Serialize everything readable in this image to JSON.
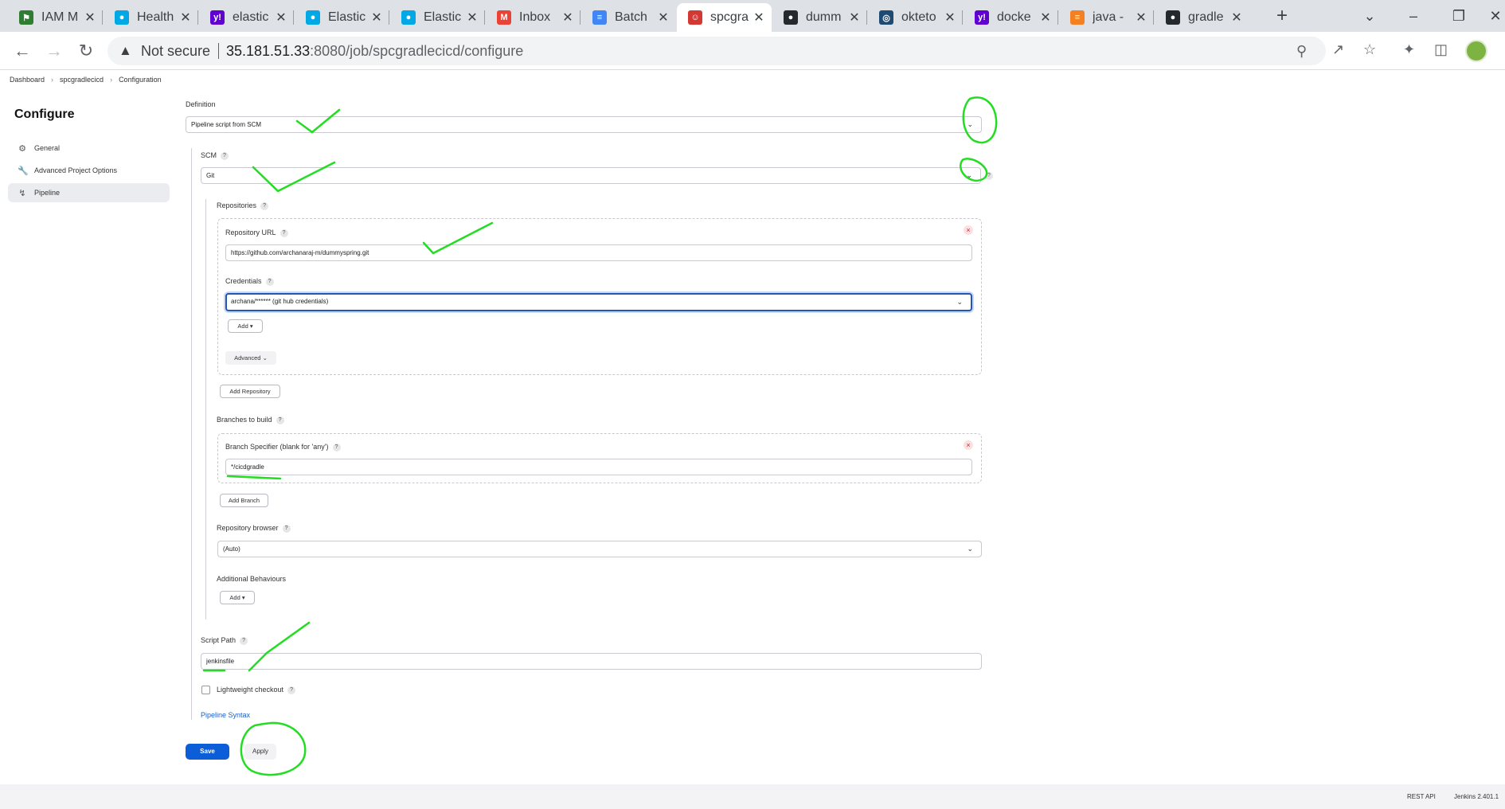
{
  "browser": {
    "tabs": [
      {
        "title": "IAM M",
        "icon": "aws-icon",
        "color": "#2e7d32"
      },
      {
        "title": "Health",
        "icon": "elastic-icon",
        "color": "#00a9e5"
      },
      {
        "title": "elastic",
        "icon": "yahoo-icon",
        "color": "#6001d2"
      },
      {
        "title": "Elastic",
        "icon": "elastic-icon",
        "color": "#00a9e5"
      },
      {
        "title": "Elastic",
        "icon": "elastic-icon",
        "color": "#00a9e5"
      },
      {
        "title": "Inbox",
        "icon": "gmail-icon",
        "color": "#ea4335"
      },
      {
        "title": "Batch",
        "icon": "docs-icon",
        "color": "#4285f4"
      },
      {
        "title": "spcgra",
        "icon": "jenkins-icon",
        "color": "#d33833"
      },
      {
        "title": "dumm",
        "icon": "github-icon",
        "color": "#24292e"
      },
      {
        "title": "okteto",
        "icon": "okteto-icon",
        "color": "#1f4a72"
      },
      {
        "title": "docke",
        "icon": "yahoo-icon",
        "color": "#6001d2"
      },
      {
        "title": "java -",
        "icon": "stackoverflow-icon",
        "color": "#f48024"
      },
      {
        "title": "gradle",
        "icon": "github-icon",
        "color": "#24292e"
      }
    ],
    "not_secure": "Not secure",
    "url_host": "35.181.51.33",
    "url_path": ":8080/job/spcgradlecicd/configure"
  },
  "breadcrumb": {
    "items": [
      "Dashboard",
      "spcgradlecicd",
      "Configuration"
    ]
  },
  "sidebar": {
    "title": "Configure",
    "items": [
      {
        "label": "General",
        "icon": "gear-icon"
      },
      {
        "label": "Advanced Project Options",
        "icon": "wrench-icon"
      },
      {
        "label": "Pipeline",
        "icon": "pipeline-icon"
      }
    ]
  },
  "form": {
    "definition_label": "Definition",
    "definition_value": "Pipeline script from SCM",
    "scm_label": "SCM",
    "scm_value": "Git",
    "repositories_label": "Repositories",
    "repo_url_label": "Repository URL",
    "repo_url_value": "https://github.com/archanaraj-m/dummyspring.git",
    "credentials_label": "Credentials",
    "credentials_value": "archana/****** (git hub credentials)",
    "add_label": "Add",
    "advanced_label": "Advanced",
    "add_repository_label": "Add Repository",
    "branches_label": "Branches to build",
    "branch_spec_label": "Branch Specifier (blank for 'any')",
    "branch_spec_value": "*/cicdgradle",
    "add_branch_label": "Add Branch",
    "repo_browser_label": "Repository browser",
    "repo_browser_value": "(Auto)",
    "additional_behaviours_label": "Additional Behaviours",
    "add_behaviour_label": "Add",
    "script_path_label": "Script Path",
    "script_path_value": "jenkinsfile",
    "lightweight_label": "Lightweight checkout",
    "pipeline_syntax_label": "Pipeline Syntax",
    "save_label": "Save",
    "apply_label": "Apply"
  },
  "footer": {
    "rest_api": "REST API",
    "version": "Jenkins 2.401.1"
  },
  "colors": {
    "annotation": "#22dd22",
    "primary": "#0b5ed7",
    "link": "#1a5ec5"
  }
}
